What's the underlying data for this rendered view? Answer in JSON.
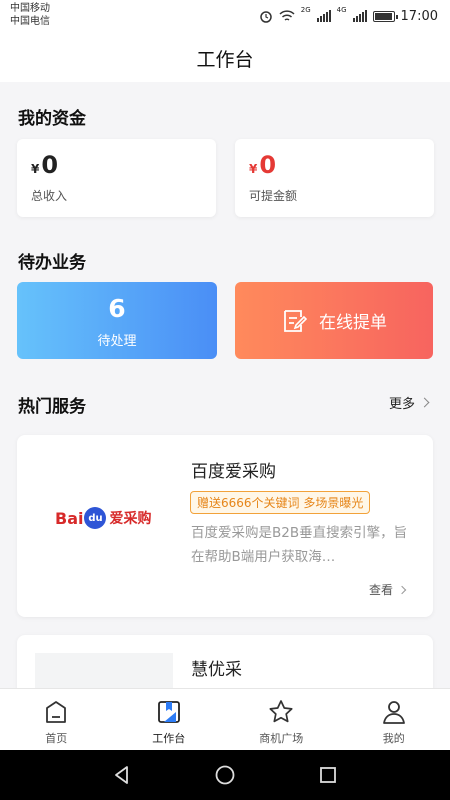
{
  "status_bar": {
    "carrier1": "中国移动",
    "carrier2": "中国电信",
    "net1": "2G",
    "net2": "4G",
    "time": "17:00",
    "battery_level": 0.95
  },
  "header": {
    "title": "工作台"
  },
  "funds": {
    "title": "我的资金",
    "currency": "¥",
    "income": {
      "value": "0",
      "label": "总收入"
    },
    "withdrawable": {
      "value": "0",
      "label": "可提金额"
    },
    "income_color": "#222222",
    "withdraw_color": "#e53935"
  },
  "tasks": {
    "title": "待办业务",
    "pending_count": "6",
    "pending_label": "待处理",
    "order_label": "在线提单"
  },
  "services": {
    "title": "热门服务",
    "more_label": "更多",
    "items": [
      {
        "logo_text": "Bai",
        "logo_paw": "du",
        "logo_cn": "爱采购",
        "name": "百度爱采购",
        "tag": "赠送6666个关键词 多场景曝光",
        "description": "百度爱采购是B2B垂直搜索引擎，旨在帮助B端用户获取海…",
        "view_label": "查看"
      },
      {
        "name": "慧优采"
      }
    ]
  },
  "tabbar": {
    "tabs": [
      {
        "label": "首页",
        "icon": "home-icon"
      },
      {
        "label": "工作台",
        "icon": "workbench-icon"
      },
      {
        "label": "商机广场",
        "icon": "star-icon"
      },
      {
        "label": "我的",
        "icon": "user-icon"
      }
    ],
    "active_color": "#2d7cf6"
  }
}
